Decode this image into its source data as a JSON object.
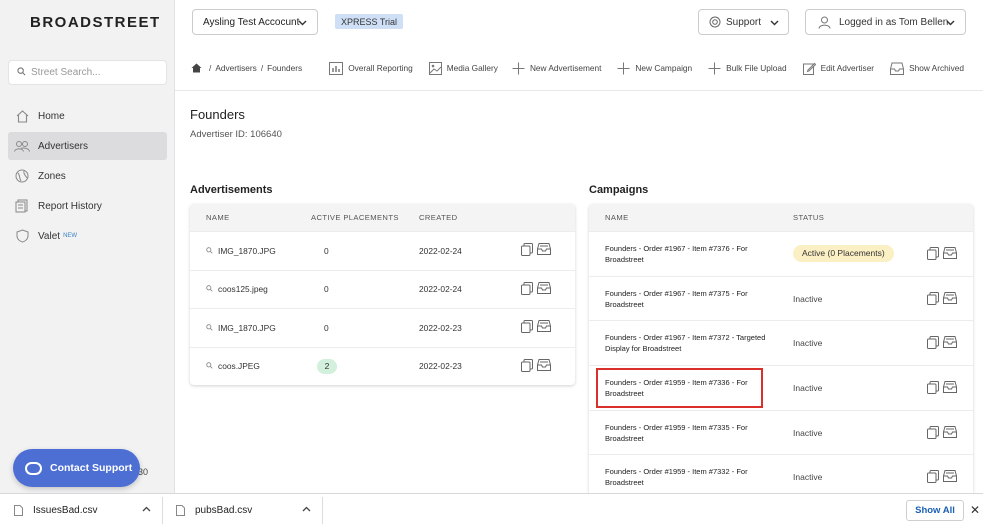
{
  "logo": "BROADSTREET",
  "search": {
    "placeholder": "Street Search..."
  },
  "nav": [
    {
      "label": "Home",
      "icon": "house-icon"
    },
    {
      "label": "Advertisers",
      "icon": "users-icon",
      "active": true
    },
    {
      "label": "Zones",
      "icon": "globe-icon"
    },
    {
      "label": "Report History",
      "icon": "report-icon"
    },
    {
      "label": "Valet",
      "icon": "shield-icon",
      "badge": "NEW"
    }
  ],
  "support_button": "Contact Support",
  "sidebar_bottom_text": "30",
  "topbar": {
    "account": "Aysling Test Accocunt",
    "trial": "XPRESS Trial",
    "support": "Support",
    "user": "Logged in as Tom Bellen"
  },
  "breadcrumb": {
    "level1": "Advertisers",
    "level2": "Founders"
  },
  "toolbar": {
    "overall_reporting": "Overall Reporting",
    "media_gallery": "Media Gallery",
    "new_advertisement": "New Advertisement",
    "new_campaign": "New Campaign",
    "bulk_file_upload": "Bulk File Upload",
    "edit_advertiser": "Edit Advertiser",
    "show_archived": "Show Archived"
  },
  "page": {
    "title": "Founders",
    "advertiser_id": "Advertiser ID: 106640"
  },
  "ads": {
    "title": "Advertisements",
    "headers": {
      "name": "NAME",
      "active_placements": "ACTIVE PLACEMENTS",
      "created": "CREATED"
    },
    "rows": [
      {
        "name": "IMG_1870.JPG",
        "placements": "0",
        "created": "2022-02-24"
      },
      {
        "name": "coos125.jpeg",
        "placements": "0",
        "created": "2022-02-24"
      },
      {
        "name": "IMG_1870.JPG",
        "placements": "0",
        "created": "2022-02-23"
      },
      {
        "name": "coos.JPEG",
        "placements": "2",
        "created": "2022-02-23"
      }
    ]
  },
  "campaigns": {
    "title": "Campaigns",
    "headers": {
      "name": "NAME",
      "status": "STATUS"
    },
    "rows": [
      {
        "name": "Founders - Order #1967 - Item #7376 - For Broadstreet",
        "status": "Active (0 Placements)"
      },
      {
        "name": "Founders - Order #1967 - Item #7375 - For Broadstreet",
        "status": "Inactive"
      },
      {
        "name": "Founders - Order #1967 - Item #7372 - Targeted Display for Broadstreet",
        "status": "Inactive"
      },
      {
        "name": "Founders - Order #1959 - Item #7336 - For Broadstreet",
        "status": "Inactive"
      },
      {
        "name": "Founders - Order #1959 - Item #7335 - For Broadstreet",
        "status": "Inactive"
      },
      {
        "name": "Founders - Order #1959 - Item #7332 - For Broadstreet",
        "status": "Inactive"
      }
    ]
  },
  "downloads": {
    "file1": "IssuesBad.csv",
    "file2": "pubsBad.csv",
    "show_all": "Show All"
  },
  "colors": {
    "accent": "#4d6fd4",
    "highlight": "#d9302c",
    "active_badge": "#fbefc4",
    "placement_badge": "#d3f0dc"
  }
}
